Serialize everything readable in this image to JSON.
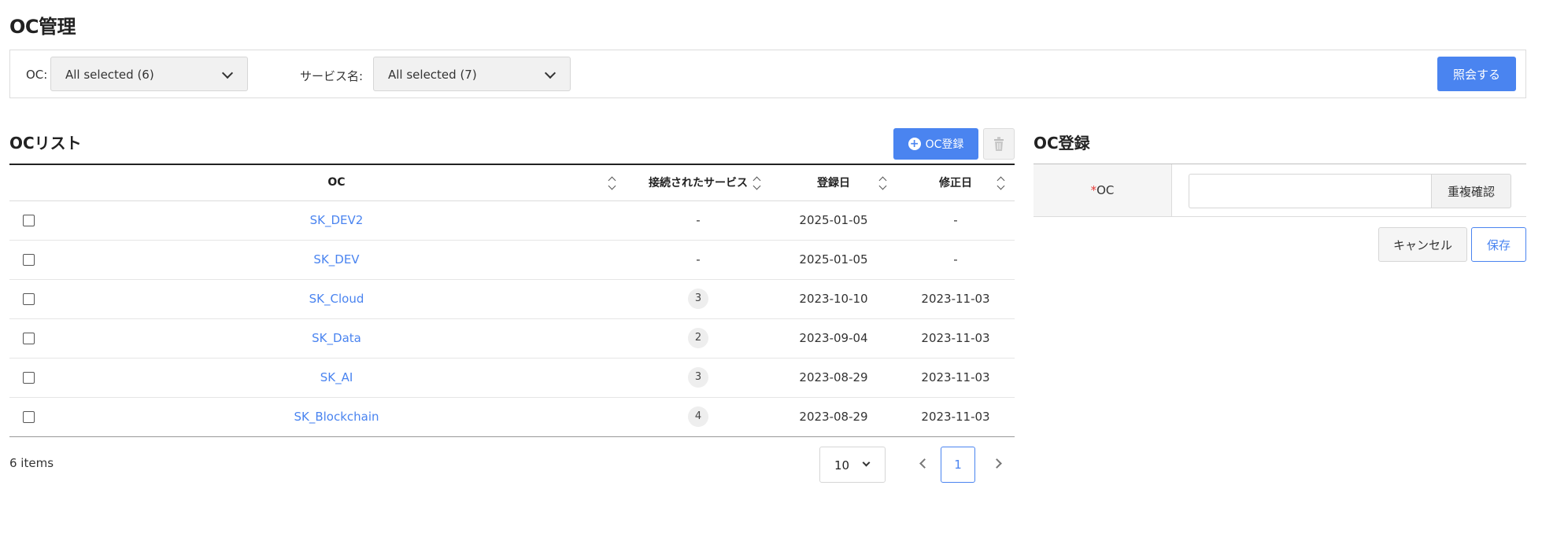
{
  "page": {
    "title": "OC管理"
  },
  "filters": {
    "oc_label": "OC:",
    "oc_selected": "All selected (6)",
    "service_label": "サービス名:",
    "service_selected": "All selected (7)",
    "query_button": "照会する"
  },
  "list": {
    "title": "OCリスト",
    "register_button": "OC登録",
    "columns": [
      "OC",
      "接続されたサービス",
      "登録日",
      "修正日"
    ],
    "rows": [
      {
        "oc": "SK_DEV2",
        "services": "-",
        "created": "2025-01-05",
        "modified": "-"
      },
      {
        "oc": "SK_DEV",
        "services": "-",
        "created": "2025-01-05",
        "modified": "-"
      },
      {
        "oc": "SK_Cloud",
        "services": "3",
        "created": "2023-10-10",
        "modified": "2023-11-03"
      },
      {
        "oc": "SK_Data",
        "services": "2",
        "created": "2023-09-04",
        "modified": "2023-11-03"
      },
      {
        "oc": "SK_AI",
        "services": "3",
        "created": "2023-08-29",
        "modified": "2023-11-03"
      },
      {
        "oc": "SK_Blockchain",
        "services": "4",
        "created": "2023-08-29",
        "modified": "2023-11-03"
      }
    ],
    "items_count": "6 items",
    "page_size": "10",
    "current_page": "1"
  },
  "form": {
    "title": "OC登録",
    "required_mark": "*",
    "oc_label": "OC",
    "oc_value": "",
    "duplicate_check_button": "重複確認",
    "cancel_button": "キャンセル",
    "save_button": "保存"
  },
  "colors": {
    "accent": "#4a84f0",
    "required": "#e53935"
  },
  "icons": [
    "chevron-down-icon",
    "plus-circle-icon",
    "trash-icon",
    "sort-icon",
    "chevron-left-icon",
    "chevron-right-icon"
  ]
}
